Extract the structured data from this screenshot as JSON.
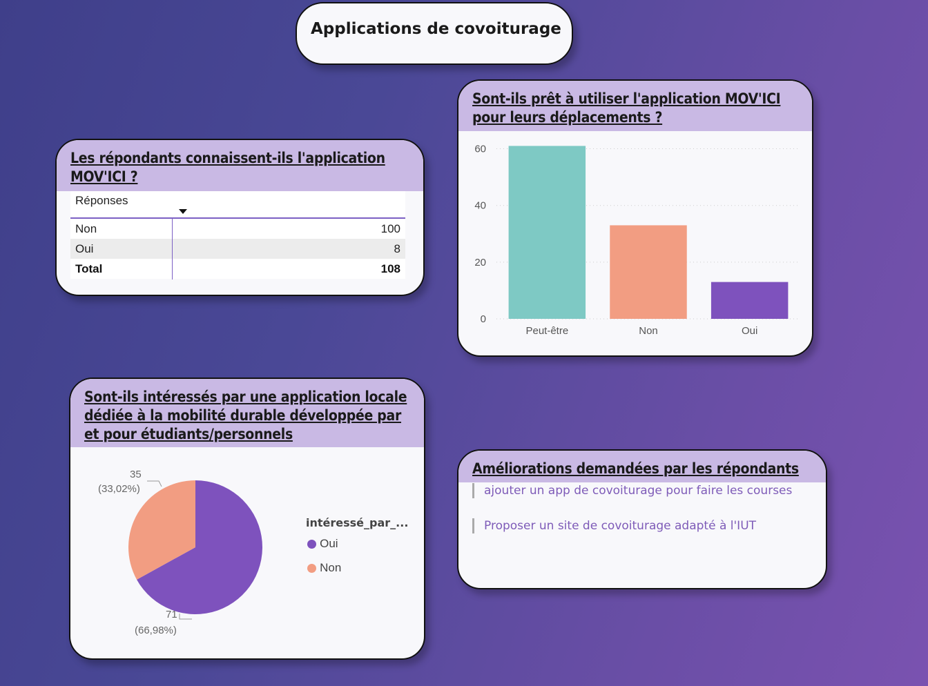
{
  "page": {
    "title": "Applications de covoiturage"
  },
  "know_card": {
    "title": "Les répondants connaissent-ils l'application MOV'ICI ?",
    "column_header": "Réponses",
    "rows": [
      {
        "label": "Non",
        "value": "100"
      },
      {
        "label": "Oui",
        "value": "8"
      },
      {
        "label": "Total",
        "value": "108"
      }
    ]
  },
  "ready_card": {
    "title": "Sont-ils prêt à utiliser l'application MOV'ICI pour leurs déplacements ?"
  },
  "interest_card": {
    "title": "Sont-ils intéressés par une application locale dédiée à la mobilité durable développée par et pour étudiants/personnels",
    "legend_title": "intéressé_par_...",
    "label_non_value": "35",
    "label_non_pct": "(33,02%)",
    "label_oui_value": "71",
    "label_oui_pct": "(66,98%)"
  },
  "improvements_card": {
    "title": "Améliorations demandées par les répondants",
    "items": [
      "ajouter un app de covoiturage pour faire les courses",
      "Proposer un site de covoiturage adapté à l'IUT"
    ]
  },
  "colors": {
    "teal": "#7ec9c4",
    "salmon": "#f29d82",
    "purple": "#7e52bd",
    "header_bg": "#c9b9e4"
  },
  "chart_data": [
    {
      "type": "bar",
      "title": "Sont-ils prêt à utiliser l'application MOV'ICI pour leurs déplacements ?",
      "categories": [
        "Peut-être",
        "Non",
        "Oui"
      ],
      "values": [
        61,
        33,
        13
      ],
      "colors": [
        "#7ec9c4",
        "#f29d82",
        "#7e52bd"
      ],
      "yticks": [
        "0",
        "20",
        "40",
        "60"
      ],
      "ylim": [
        0,
        65
      ],
      "grid": true
    },
    {
      "type": "pie",
      "title": "Sont-ils intéressés par une application locale dédiée à la mobilité durable développée par et pour étudiants/personnels",
      "labels": [
        "Oui",
        "Non"
      ],
      "values": [
        71,
        35
      ],
      "percentages": [
        "66,98%",
        "33,02%"
      ],
      "colors": [
        "#7e52bd",
        "#f29d82"
      ],
      "legend_title": "intéressé_par_...",
      "legend": "right"
    }
  ]
}
